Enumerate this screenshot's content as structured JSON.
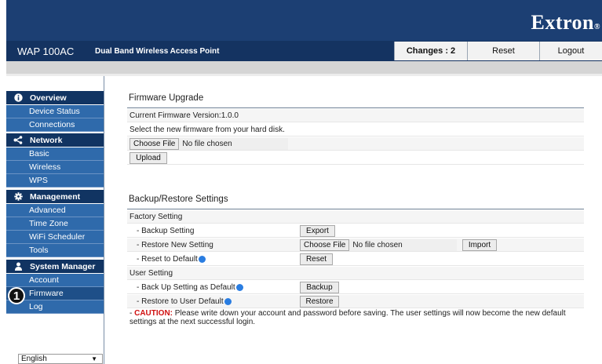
{
  "header": {
    "brand": "Extron",
    "brand_mark": "®",
    "model": "WAP 100AC",
    "product": "Dual Band Wireless Access Point",
    "changes_label": "Changes : 2",
    "reset_label": "Reset",
    "logout_label": "Logout"
  },
  "sidebar": {
    "sections": [
      {
        "label": "Overview",
        "icon": "info-icon",
        "items": [
          "Device Status",
          "Connections"
        ]
      },
      {
        "label": "Network",
        "icon": "share-icon",
        "items": [
          "Basic",
          "Wireless",
          "WPS"
        ]
      },
      {
        "label": "Management",
        "icon": "gear-icon",
        "items": [
          "Advanced",
          "Time Zone",
          "WiFi Scheduler",
          "Tools"
        ]
      },
      {
        "label": "System Manager",
        "icon": "user-icon",
        "items": [
          "Account",
          "Firmware",
          "Log"
        ]
      }
    ],
    "active_item": "Firmware",
    "callout_number": "1",
    "language": "English"
  },
  "firmware": {
    "title": "Firmware Upgrade",
    "current_version": "Current Firmware Version:1.0.0",
    "select_text": "Select the new firmware from your hard disk.",
    "choose_file_label": "Choose File",
    "no_file_text": "No file chosen",
    "upload_label": "Upload"
  },
  "backup": {
    "title": "Backup/Restore Settings",
    "factory_heading": "Factory Setting",
    "backup_setting_label": "- Backup Setting",
    "export_label": "Export",
    "restore_new_label": "- Restore New Setting",
    "choose_file_label": "Choose File",
    "no_file_text": "No file chosen",
    "import_label": "Import",
    "reset_default_label": "- Reset to Default",
    "reset_label": "Reset",
    "user_heading": "User Setting",
    "backup_user_label": "- Back Up Setting as Default",
    "backup_label": "Backup",
    "restore_user_label": "- Restore to User Default",
    "restore_label": "Restore",
    "caution_prefix": "- ",
    "caution_word": "CAUTION:",
    "caution_text": " Please write down your account and password before saving. The user settings will now become the new default settings at the next successful login."
  }
}
